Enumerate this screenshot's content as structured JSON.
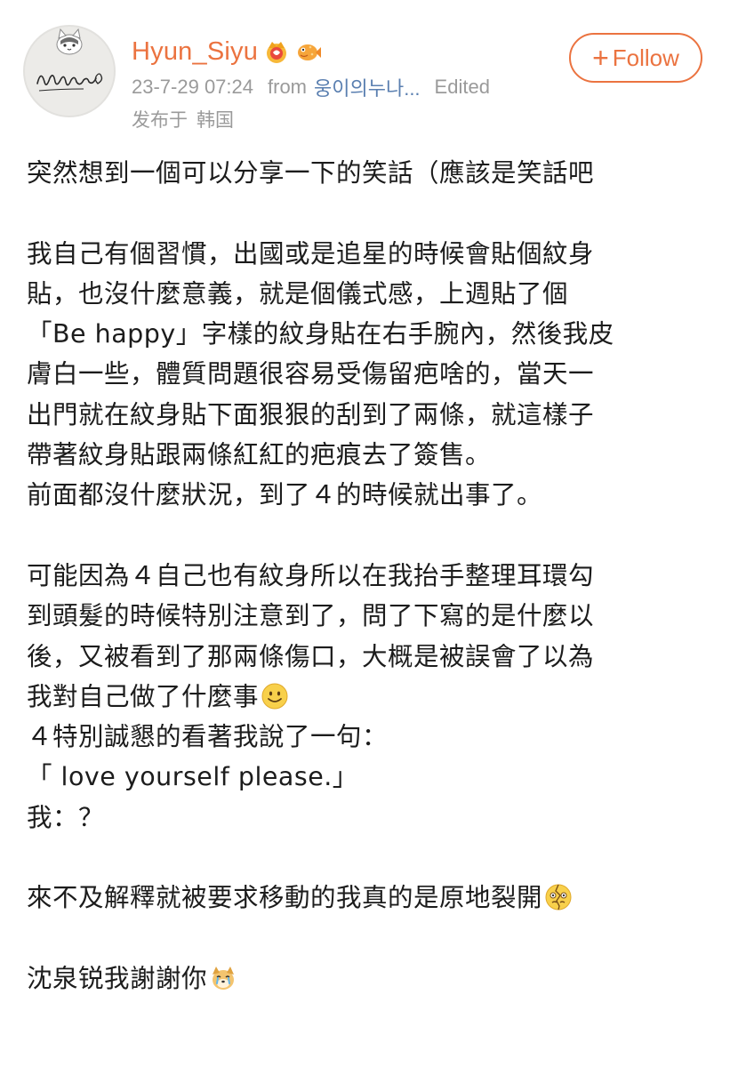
{
  "post": {
    "author": {
      "name": "Hyun_Siyu",
      "avatar_text": "Hyun Siyu signature",
      "badges": [
        "crown-vip-badge",
        "fish-badge"
      ]
    },
    "meta": {
      "timestamp": "23-7-29 07:24",
      "from_label": "from",
      "source": "웅이의누나...",
      "edited_label": "Edited"
    },
    "location": {
      "label": "发布于",
      "place": "韩国"
    },
    "follow_button": {
      "label": "Follow",
      "icon": "plus-icon"
    },
    "body": {
      "lines": [
        "突然想到一個可以分享一下的笑話（應該是笑話吧",
        "",
        "我自己有個習慣，出國或是追星的時候會貼個紋身",
        "貼，也沒什麼意義，就是個儀式感，上週貼了個",
        "「Be happy」字樣的紋身貼在右手腕內，然後我皮",
        "膚白一些，體質問題很容易受傷留疤啥的，當天一",
        "出門就在紋身貼下面狠狠的刮到了兩條，就這樣子",
        "帶著紋身貼跟兩條紅紅的疤痕去了簽售。",
        "前面都沒什麼狀況，到了４的時候就出事了。",
        "",
        "可能因為４自己也有紋身所以在我抬手整理耳環勾",
        "到頭髮的時候特別注意到了，問了下寫的是什麼以",
        "後，又被看到了那兩條傷口，大概是被誤會了以為",
        "我對自己做了什麼事",
        "４特別誠懇的看著我說了一句：",
        "「 love yourself please.」",
        "我：？",
        "",
        "來不及解釋就被要求移動的我真的是原地裂開",
        "",
        "沈泉锐我謝謝你"
      ],
      "inline_emojis": {
        "line_13": "smile-emoji",
        "line_18": "cracked-face-emoji",
        "line_20": "crying-dog-emoji"
      }
    }
  },
  "colors": {
    "username": "#eb7340",
    "follow_accent": "#eb7340",
    "meta_gray": "#9a9a9a",
    "source_link": "#5a7fb0",
    "body_text": "#1c1c1c"
  }
}
